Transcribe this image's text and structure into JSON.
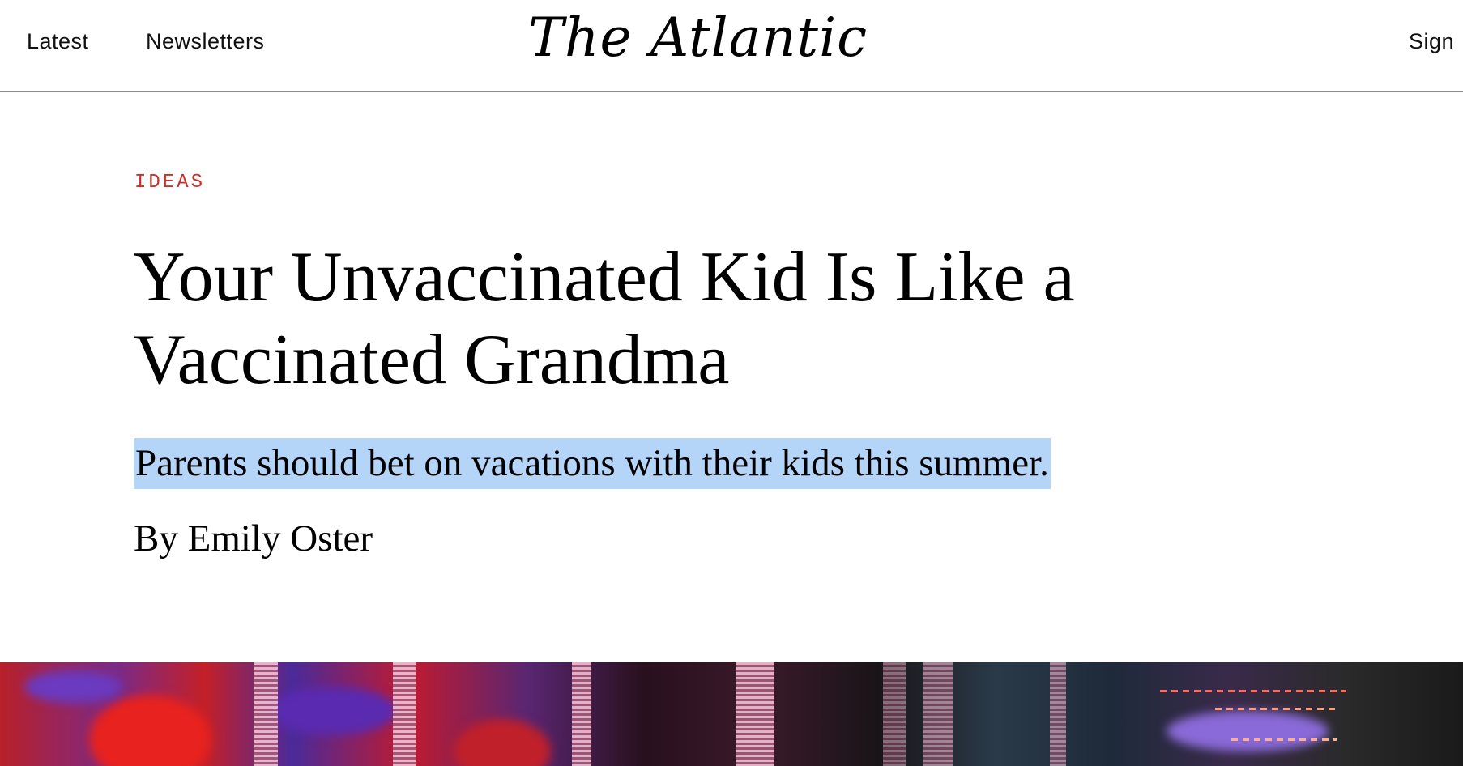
{
  "header": {
    "nav_left": [
      "Latest",
      "Newsletters"
    ],
    "logo": "The Atlantic",
    "nav_right": "Sign"
  },
  "article": {
    "section": "IDEAS",
    "headline": "Your Unvaccinated Kid Is Like a Vaccinated Grandma",
    "dek": "Parents should bet on vacations with their kids this summer.",
    "byline_prefix": "By",
    "author": "Emily Oster"
  },
  "colors": {
    "section_label": "#c8312b",
    "selection_highlight": "#b5d5f8",
    "header_rule": "#8a8a8a"
  }
}
